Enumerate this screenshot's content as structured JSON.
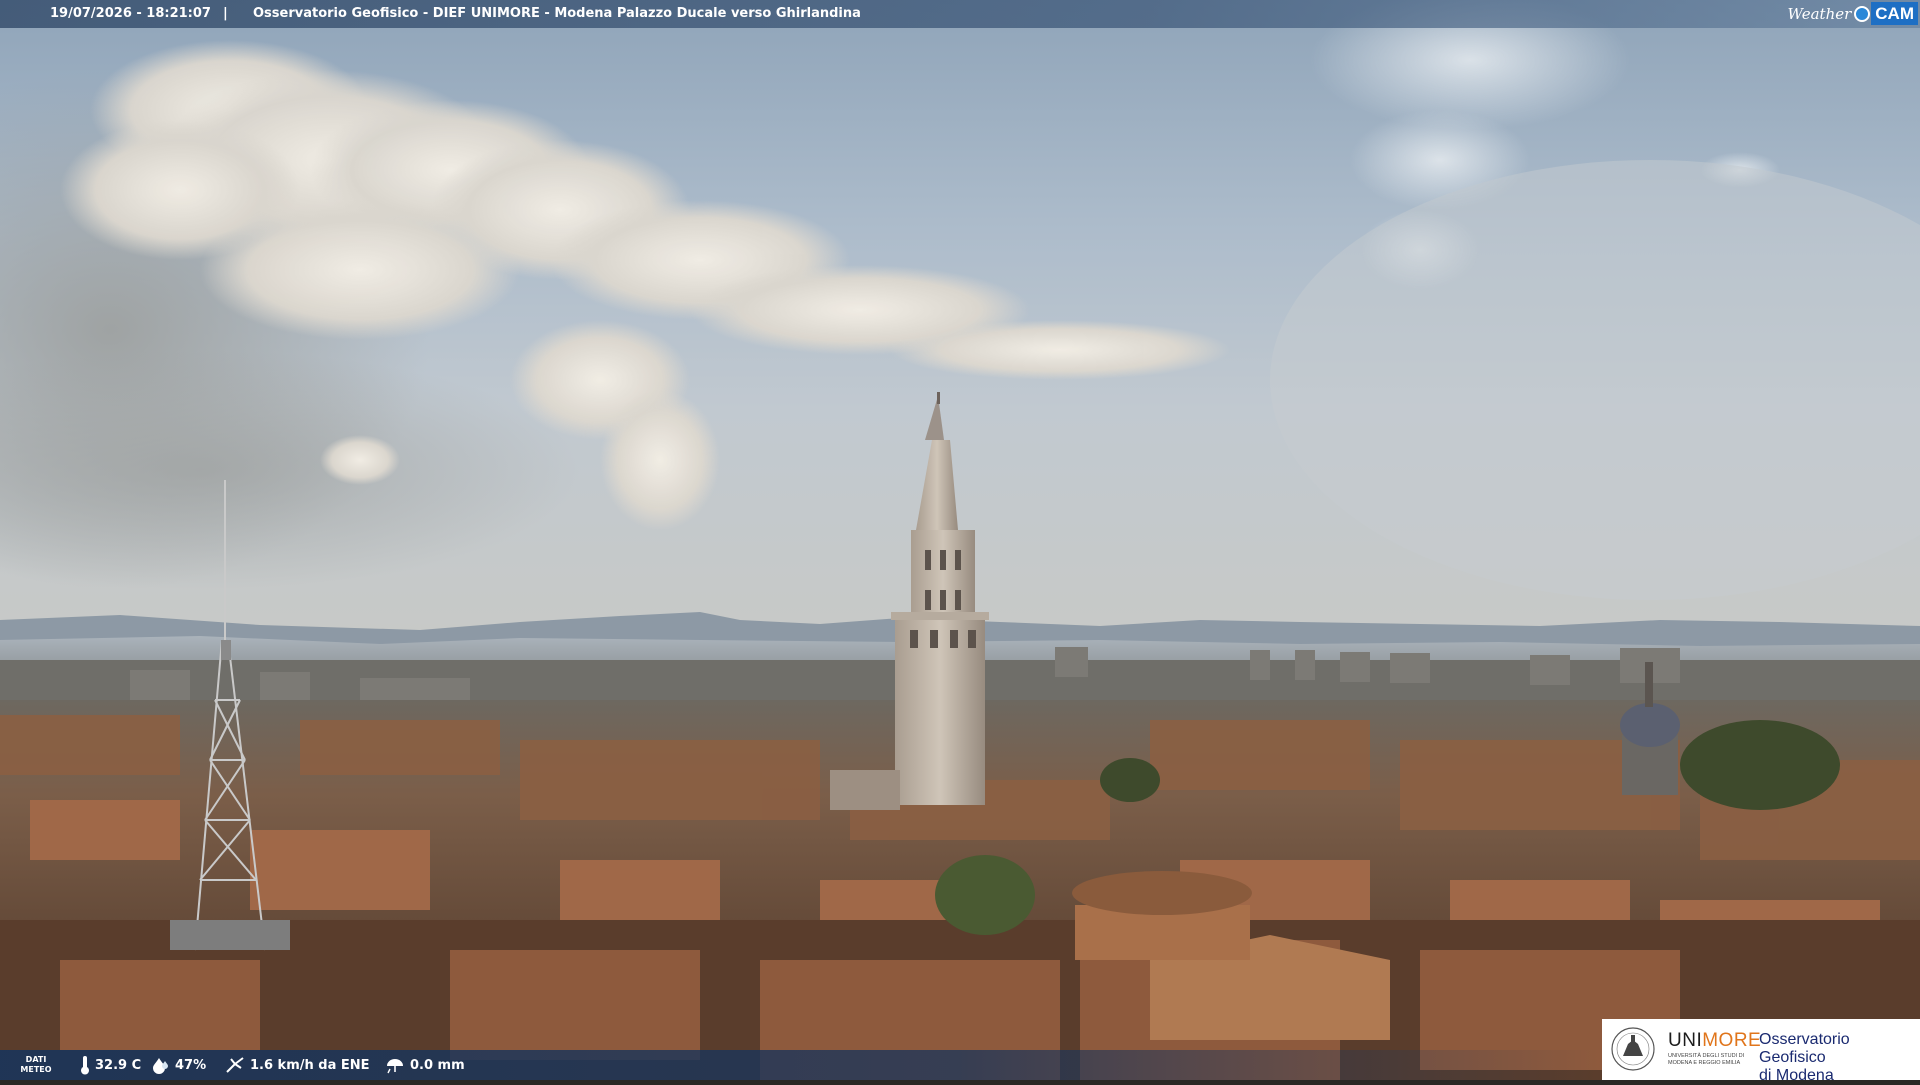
{
  "header": {
    "timestamp": "19/07/2026 - 18:21:07",
    "separator": "|",
    "caption": "Osservatorio Geofisico - DIEF UNIMORE - Modena Palazzo Ducale verso Ghirlandina"
  },
  "brand_logo": {
    "word1": "Weather",
    "word2": "CAM"
  },
  "meteo": {
    "label_line1": "DATI",
    "label_line2": "METEO",
    "temperature": "32.9 C",
    "humidity": "47%",
    "wind": "1.6 km/h da ENE",
    "rain": "0.0 mm",
    "icons": [
      "thermometer-icon",
      "humidity-drop-icon",
      "wind-icon",
      "rain-icon"
    ]
  },
  "institution_logo": {
    "name_part1": "UNI",
    "name_part2": "MORE",
    "subtitle": "Università degli Studi di Modena e Reggio Emilia",
    "observatory_line1": "Osservatorio Geofisico",
    "observatory_line2": "di Modena",
    "accent_color": "#e0751b"
  },
  "scene": {
    "description_colors": {
      "sky": "#b9c6d2",
      "roofs": "#8a5a3c",
      "tower": "#c9bfb2"
    }
  }
}
